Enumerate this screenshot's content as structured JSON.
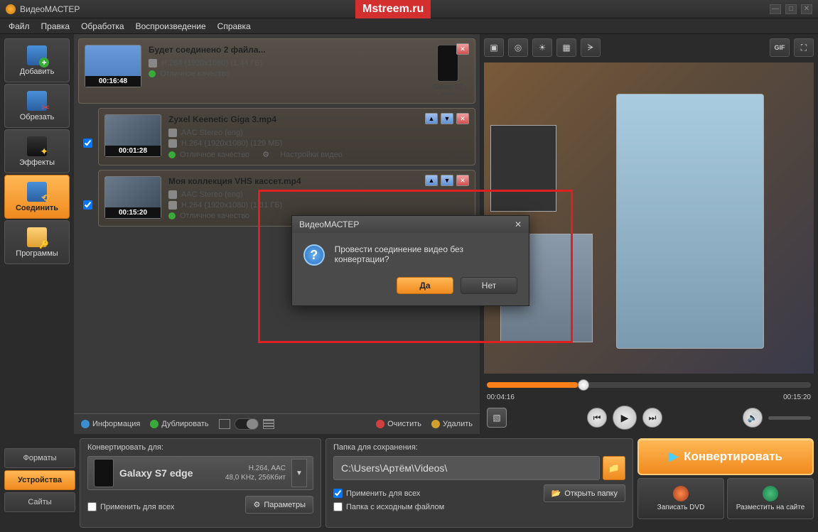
{
  "app": {
    "title": "ВидеоМАСТЕР",
    "watermark": "Mstreem.ru"
  },
  "menu": {
    "file": "Файл",
    "edit": "Правка",
    "process": "Обработка",
    "playback": "Воспроизведение",
    "help": "Справка"
  },
  "sidebar": {
    "add": "Добавить",
    "cut": "Обрезать",
    "fx": "Эффекты",
    "join": "Соединить",
    "programs": "Программы"
  },
  "files": [
    {
      "title": "Будет соединено 2 файла...",
      "format": "H.264 (1920x1080) (1,44 ГБ)",
      "quality": "Отличное качество",
      "duration": "00:16:48",
      "device": "Galaxy S7 edge"
    },
    {
      "title": "Zyxel Keenetic Giga 3.mp4",
      "audio": "AAC Stereo (eng)",
      "format": "H.264 (1920x1080) (129 МБ)",
      "quality": "Отличное качество",
      "settings": "Настройки видео",
      "duration": "00:01:28"
    },
    {
      "title": "Моя коллекция VHS кассет.mp4",
      "audio": "AAC Stereo (eng)",
      "format": "H.264 (1920x1080) (1,31 ГБ)",
      "quality": "Отличное качество",
      "duration": "00:15:20"
    }
  ],
  "listbar": {
    "info": "Информация",
    "dup": "Дублировать",
    "clear": "Очистить",
    "delete": "Удалить"
  },
  "preview": {
    "cur": "00:04:16",
    "total": "00:15:20",
    "gif": "GIF"
  },
  "footer": {
    "tabs": {
      "formats": "Форматы",
      "devices": "Устройства",
      "sites": "Сайты"
    },
    "conv_hdr": "Конвертировать для:",
    "target_name": "Galaxy S7 edge",
    "target_fmt1": "H.264, AAC",
    "target_fmt2": "48,0 KHz, 256Кбит",
    "apply_all": "Применить для всех",
    "params_btn": "Параметры",
    "save_hdr": "Папка для сохранения:",
    "save_path": "C:\\Users\\Артём\\Videos\\",
    "apply_all2": "Применить для всех",
    "source_folder": "Папка с исходным файлом",
    "open_folder": "Открыть папку",
    "convert": "Конвертировать",
    "burn": "Записать DVD",
    "upload": "Разместить на сайте"
  },
  "dialog": {
    "title": "ВидеоМАСТЕР",
    "msg": "Провести соединение видео без конвертации?",
    "yes": "Да",
    "no": "Нет"
  }
}
